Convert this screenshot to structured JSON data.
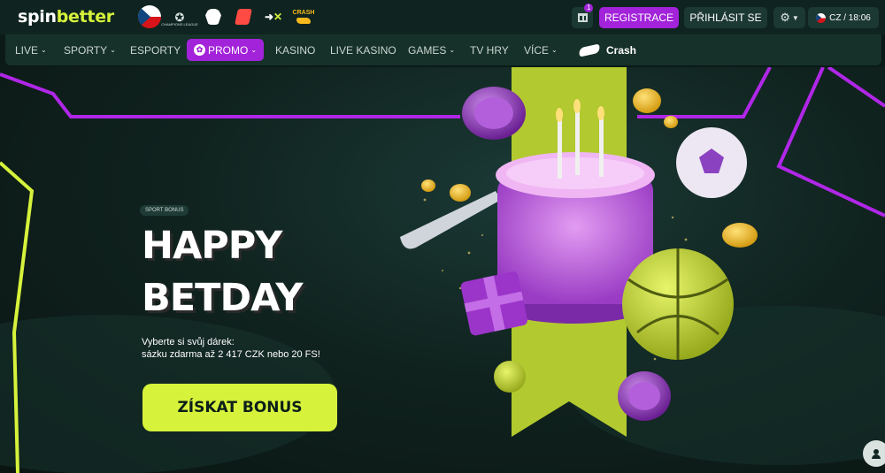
{
  "header": {
    "logo_spin": "spin",
    "logo_better": "better",
    "partners": [
      "czech-flag-icon",
      "champions-league-icon",
      "premier-league-icon",
      "laliga-icon",
      "x-icon",
      "crash-icon"
    ],
    "ucl_caption": "CHAMPIONS LEAGUE",
    "crash_caption": "CRASH",
    "gift_count": "1",
    "register_label": "REGISTRACE",
    "login_label": "PŘIHLÁSIT SE",
    "lang_time": "CZ / 18:06"
  },
  "nav": {
    "items": [
      {
        "label": "LIVE",
        "dropdown": true
      },
      {
        "label": "SPORTY",
        "dropdown": true
      },
      {
        "label": "ESPORTY",
        "dropdown": false
      },
      {
        "label": "PROMO",
        "dropdown": true,
        "active": true
      },
      {
        "label": "KASINO",
        "dropdown": false
      },
      {
        "label": "LIVE KASINO",
        "dropdown": false
      },
      {
        "label": "GAMES",
        "dropdown": true
      },
      {
        "label": "TV HRY",
        "dropdown": false
      },
      {
        "label": "VÍCE",
        "dropdown": true
      }
    ],
    "crash_label": "Crash"
  },
  "hero": {
    "badge": "SPORT BONUS",
    "title_line1": "HAPPY",
    "title_line2": "BETDAY",
    "desc_line1": "Vyberte si svůj dárek:",
    "desc_line2": "sázku zdarma až 2 417 CZK nebo 20 FS!",
    "cta_label": "ZÍSKAT BONUS"
  },
  "colors": {
    "accent_purple": "#a223d9",
    "accent_lime": "#d6f23b",
    "background": "#0f2420"
  }
}
